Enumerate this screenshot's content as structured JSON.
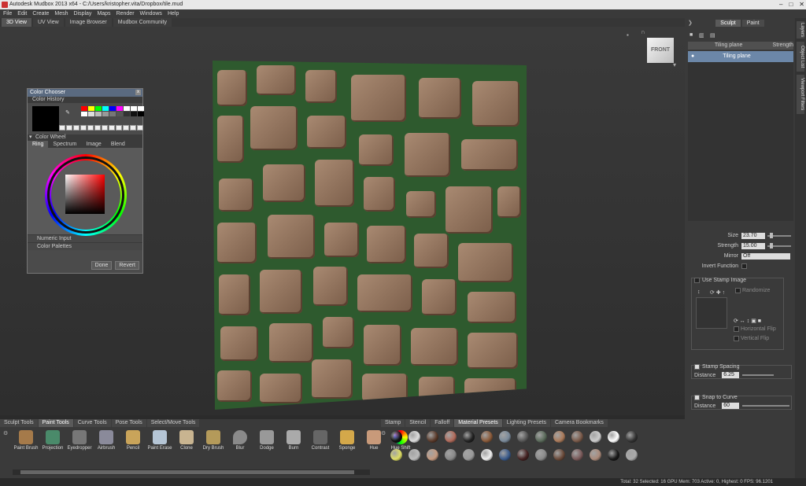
{
  "window": {
    "title": "Autodesk Mudbox 2013 x64 - C:/Users/kristopher.vita/Dropbox/tile.mud",
    "minimize": "–",
    "maximize": "□",
    "close": "✕"
  },
  "menu": [
    "File",
    "Edit",
    "Create",
    "Mesh",
    "Display",
    "Maps",
    "Render",
    "Windows",
    "Help"
  ],
  "view_tabs": [
    "3D View",
    "UV View",
    "Image Browser",
    "Mudbox Community"
  ],
  "viewcube": {
    "label": "FRONT"
  },
  "color_chooser": {
    "title": "Color Chooser",
    "close": "x",
    "history_label": "Color History",
    "wheel_label": "Color Wheel",
    "tabs": [
      "Ring",
      "Spectrum",
      "Image",
      "Blend"
    ],
    "numeric_input": "Numeric Input",
    "color_palettes": "Color Palettes",
    "done": "Done",
    "revert": "Revert",
    "palette": [
      "#ff0000",
      "#ffff00",
      "#00ff00",
      "#00ffff",
      "#0000ff",
      "#ff00ff",
      "#ffffff",
      "#ffffff",
      "#ffffff",
      "#ffffff",
      "#dddddd",
      "#bbbbbb",
      "#999999",
      "#777777",
      "#555555",
      "#333333",
      "#111111",
      "#000000"
    ]
  },
  "right_panel": {
    "tabs": [
      "Sculpt",
      "Paint"
    ],
    "layer_header_name": "Tiling plane",
    "layer_header_strength": "Strength",
    "layer_name": "Tiling plane",
    "props": {
      "size_label": "Size",
      "size": "23.70",
      "strength_label": "Strength",
      "strength": "15.00",
      "mirror_label": "Mirror",
      "mirror": "Off",
      "invert_label": "Invert Function",
      "stamp_label": "Use Stamp Image",
      "randomize": "Randomize",
      "hflip": "Horizontal Flip",
      "vflip": "Vertical Flip",
      "stamp_spacing": "Stamp Spacing",
      "distance_label": "Distance",
      "distance1": "6.25",
      "snap": "Snap to Curve",
      "distance2": "60"
    },
    "side_tabs": [
      "Layers",
      "Object List",
      "Viewport Filters"
    ]
  },
  "bottom": {
    "tool_tabs": [
      "Sculpt Tools",
      "Paint Tools",
      "Curve Tools",
      "Pose Tools",
      "Select/Move Tools"
    ],
    "tools": [
      "Paint Brush",
      "Projection",
      "Eyedropper",
      "Airbrush",
      "Pencil",
      "Paint Erase",
      "Clone",
      "Dry Brush",
      "Blur",
      "Dodge",
      "Burn",
      "Contrast",
      "Sponge",
      "Hue",
      "Hue Shift"
    ],
    "preset_tabs": [
      "Stamp",
      "Stencil",
      "Falloff",
      "Material Presets",
      "Lighting Presets",
      "Camera Bookmarks"
    ],
    "materials": [
      "#111111",
      "#dddddd",
      "#5a3a2a",
      "#b06a5a",
      "#222222",
      "#8a5a3a",
      "#7a8a9a",
      "#555555",
      "#5a6a5a",
      "#aa7a5a",
      "#7a5a4a",
      "#cccccc",
      "#ffffff",
      "#333333",
      "#dddd66",
      "#bbbbbb",
      "#c49a80",
      "#888888",
      "#999999",
      "#eeeeee",
      "#3a5a8a",
      "#442222",
      "#8a8a8a",
      "#6a4a3a",
      "#7a5a5a",
      "#aa8a7a",
      "#1a1a1a",
      "#aaaaaa"
    ]
  },
  "status": "Total: 32  Selected: 16 GPU Mem: 703  Active: 0, Highest: 0  FPS: 96.1201"
}
